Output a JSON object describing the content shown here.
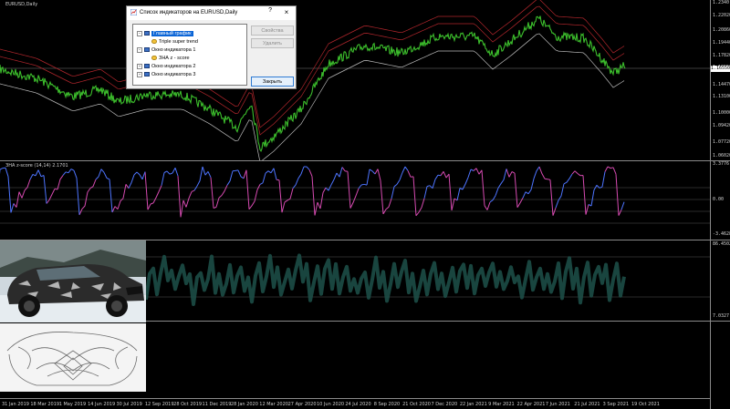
{
  "chart_title": "EURUSD,Daily",
  "main_price_labels": [
    "1.2340",
    "1.22020",
    "1.20860",
    "1.19440",
    "1.17820",
    "1.16550",
    "1.14470",
    "1.13100",
    "1.10000",
    "1.09420",
    "1.07720",
    "1.06020"
  ],
  "current_price": "1.16550",
  "indicator_title": "ЗНА z-score (14,14) 2.1701",
  "indicator_labels": [
    "3.3776",
    "0.00",
    "-3.4628"
  ],
  "photo_pane_labels": [
    "86.4502",
    "7.0327"
  ],
  "time_labels": [
    "31 Jan 2019",
    "18 Mar 2019",
    "1 May 2019",
    "14 Jun 2019",
    "30 Jul 2019",
    "12 Sep 2019",
    "28 Oct 2019",
    "11 Dec 2019",
    "28 Jan 2020",
    "12 Mar 2020",
    "27 Apr 2020",
    "10 Jun 2020",
    "24 Jul 2020",
    "8 Sep 2020",
    "21 Oct 2020",
    "7 Dec 2020",
    "22 Jan 2021",
    "9 Mar 2021",
    "22 Apr 2021",
    "7 Jun 2021",
    "21 Jul 2021",
    "3 Sep 2021",
    "19 Oct 2021"
  ],
  "dialog": {
    "title": "Список индикаторов на EURUSD,Daily",
    "help": "?",
    "close_glyph": "×",
    "tree": [
      {
        "label": "Главный график",
        "level": 0,
        "selected": true
      },
      {
        "label": "Triple super trend",
        "level": 1,
        "selected": false
      },
      {
        "label": "Окно индикатора 1",
        "level": 0,
        "selected": false
      },
      {
        "label": "ЗНА  z - score",
        "level": 1,
        "selected": false
      },
      {
        "label": "Окно индикатора 2",
        "level": 0,
        "selected": false
      },
      {
        "label": "Окно индикатора 3",
        "level": 0,
        "selected": false
      }
    ],
    "buttons": {
      "properties": "Свойства",
      "delete": "Удалить",
      "close": "Закрыть"
    }
  },
  "colors": {
    "price": "#3cbe2c",
    "supertrend_red": "#b0262c",
    "supertrend_gray": "#b9b9b9",
    "zscore_a": "#d54ab0",
    "zscore_b": "#4d74ff",
    "pane3": "#1c4d46"
  }
}
